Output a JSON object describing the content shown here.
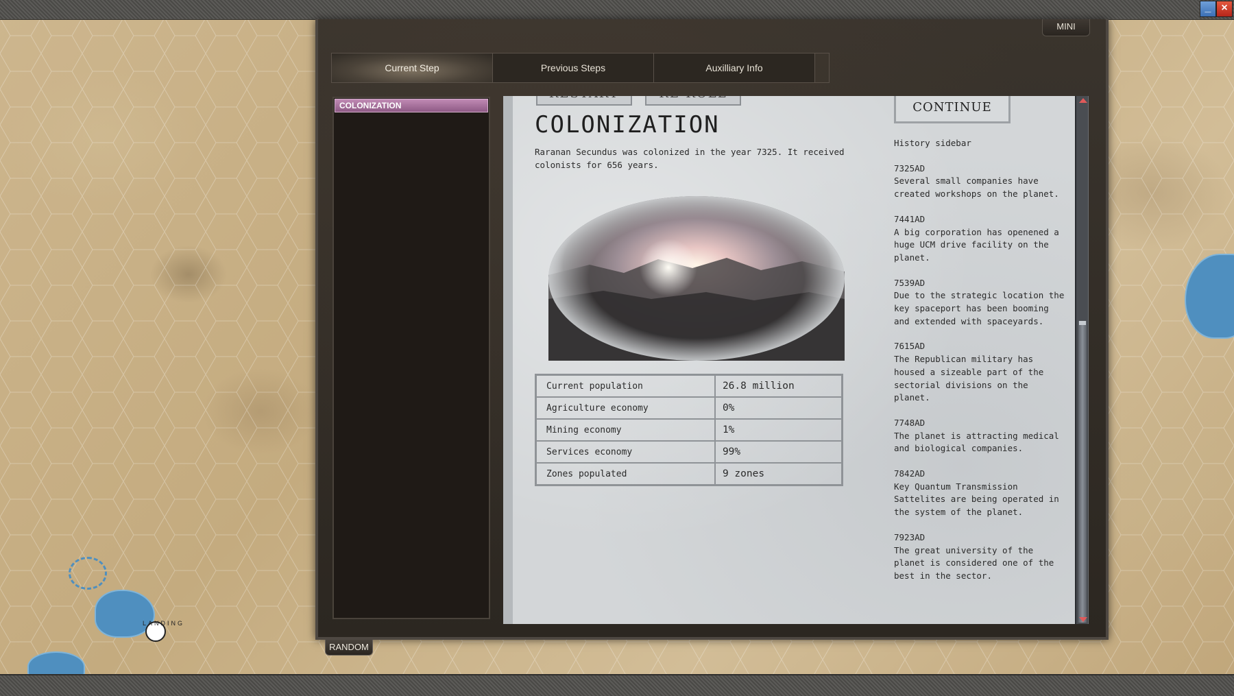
{
  "window": {
    "minimize_icon": "minimize-icon",
    "close_icon": "close-icon",
    "mini_label": "MINI"
  },
  "tabs": [
    {
      "label": "Current Step",
      "active": true
    },
    {
      "label": "Previous Steps",
      "active": false
    },
    {
      "label": "Auxilliary Info",
      "active": false
    }
  ],
  "steps": [
    {
      "label": "COLONIZATION",
      "selected": true
    }
  ],
  "document": {
    "top_buttons": {
      "restart_label": "RESTART",
      "reroll_label": "RE-ROLL",
      "continue_label": "CONTINUE"
    },
    "title": "COLONIZATION",
    "intro": "Raranan Secundus was colonized in the year 7325. It received colonists for 656 years.",
    "stats": [
      {
        "label": "Current population",
        "value": "26.8 million"
      },
      {
        "label": "Agriculture economy",
        "value": "0%"
      },
      {
        "label": "Mining economy",
        "value": "1%"
      },
      {
        "label": "Services economy",
        "value": "99%"
      },
      {
        "label": "Zones populated",
        "value": "9 zones"
      }
    ],
    "sidebar_title": "History sidebar",
    "history": [
      {
        "year": "7325AD",
        "text": "Several small companies have created workshops on the planet."
      },
      {
        "year": "7441AD",
        "text": "A big corporation has openened a huge UCM drive facility on the planet."
      },
      {
        "year": "7539AD",
        "text": "Due to the strategic location the key spaceport has been booming and extended with spaceyards."
      },
      {
        "year": "7615AD",
        "text": "The Republican military has housed a sizeable part of the sectorial divisions on the planet."
      },
      {
        "year": "7748AD",
        "text": "The planet is attracting medical and biological companies."
      },
      {
        "year": "7842AD",
        "text": "Key Quantum Transmission Sattelites are being operated in the system of the planet."
      },
      {
        "year": "7923AD",
        "text": "The great university of the planet is considered one of the best in the sector."
      }
    ]
  },
  "random_label": "RANDOM",
  "map": {
    "landing_label": "LANDING",
    "water_color": "#4f8fbf"
  }
}
